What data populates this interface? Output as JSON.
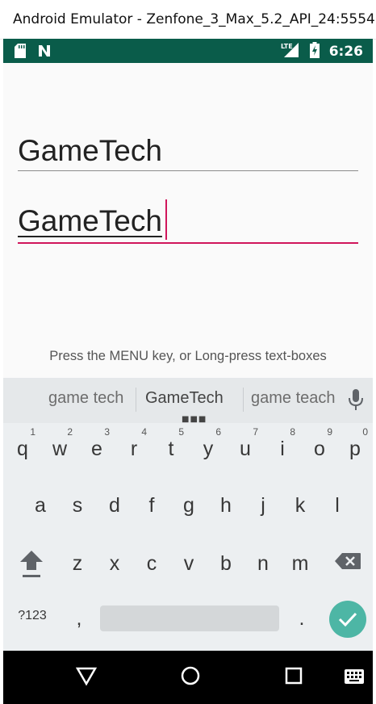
{
  "window": {
    "title": "Android Emulator - Zenfone_3_Max_5.2_API_24:5554"
  },
  "status_bar": {
    "clock": "6:26",
    "network": "LTE"
  },
  "app": {
    "field1_text": "GameTech",
    "field2_text": "GameTech",
    "hint": "Press the MENU key, or Long-press text-boxes"
  },
  "keyboard": {
    "suggestions": [
      "game tech",
      "GameTech",
      "game teach"
    ],
    "row1": [
      "q",
      "w",
      "e",
      "r",
      "t",
      "y",
      "u",
      "i",
      "o",
      "p"
    ],
    "row1_nums": [
      "1",
      "2",
      "3",
      "4",
      "5",
      "6",
      "7",
      "8",
      "9",
      "0"
    ],
    "row2": [
      "a",
      "s",
      "d",
      "f",
      "g",
      "h",
      "j",
      "k",
      "l"
    ],
    "row3": [
      "z",
      "x",
      "c",
      "v",
      "b",
      "n",
      "m"
    ],
    "symbols_label": "?123",
    "comma": ",",
    "period": "."
  },
  "colors": {
    "status_bar": "#0a5c4a",
    "accent": "#d0165b",
    "enter_key": "#4db6a5"
  }
}
